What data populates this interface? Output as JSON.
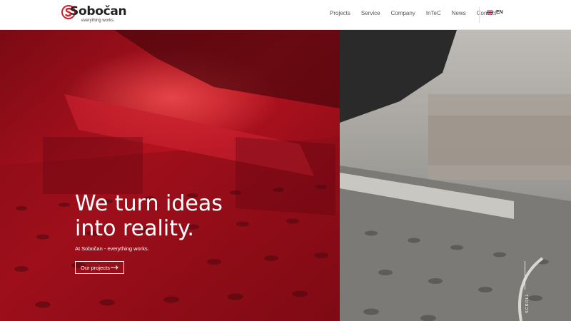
{
  "brand": {
    "name": "Sobočan",
    "tagline": "everything works.",
    "accent_color": "#d3202a"
  },
  "nav": {
    "items": [
      {
        "label": "Projects"
      },
      {
        "label": "Service"
      },
      {
        "label": "Company"
      },
      {
        "label": "InTeC"
      },
      {
        "label": "News"
      },
      {
        "label": "Contact"
      }
    ],
    "language": {
      "label": "EN",
      "icon": "uk-flag-icon"
    }
  },
  "hero": {
    "title_line1": "We turn ideas",
    "title_line2": "into reality.",
    "subtitle": "At Sobočan - everything works.",
    "cta_label": "Our projects",
    "cta_icon": "arrow-right-icon",
    "scroll_label": "SCROLL",
    "overlay_color": "#c8102e"
  }
}
